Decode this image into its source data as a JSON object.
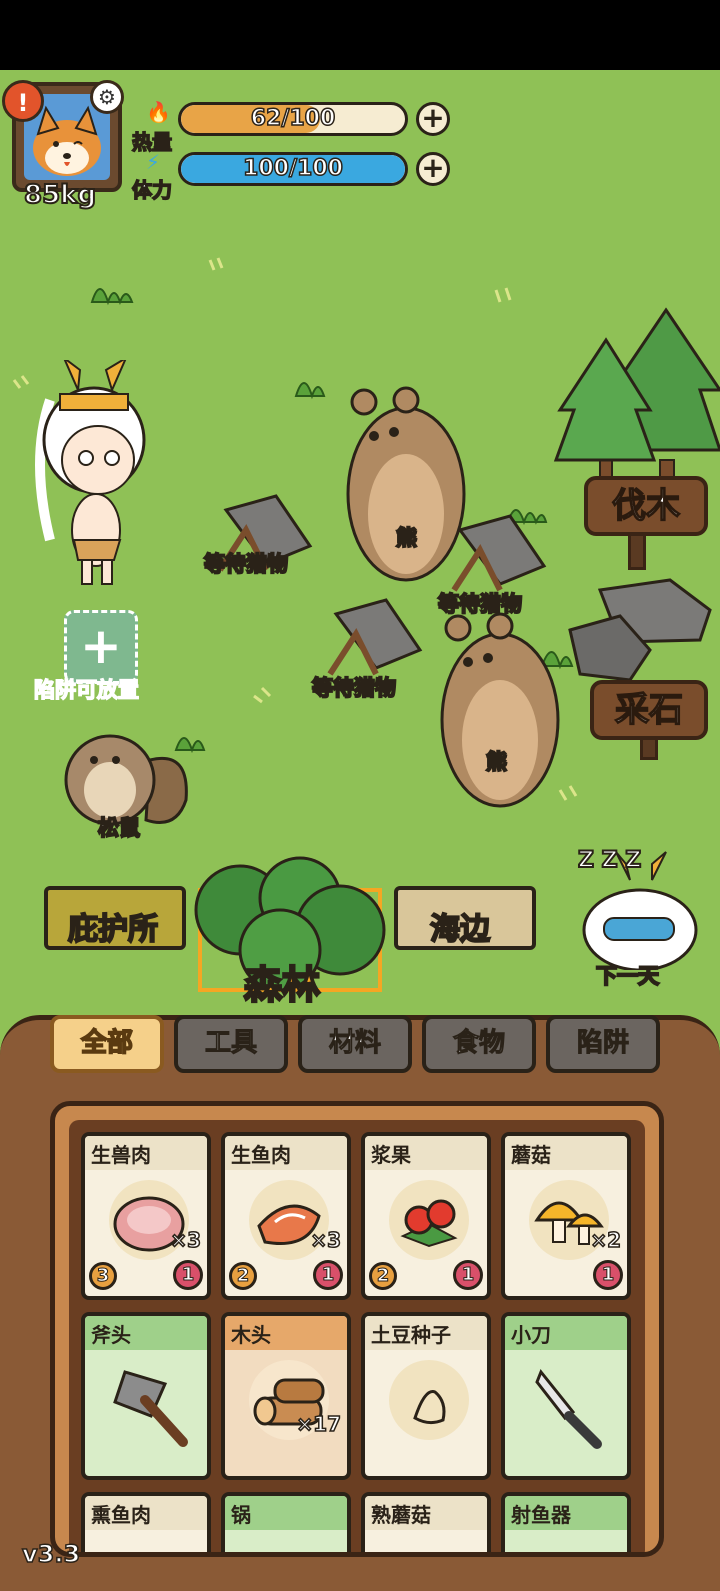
{
  "hud": {
    "weight": "85kg",
    "alert_icon": "!",
    "heat": {
      "label": "热量",
      "value": "62/100",
      "fill": 0.62,
      "color": "#e8a447"
    },
    "stamina": {
      "label": "体力",
      "value": "100/100",
      "fill": 1.0,
      "color": "#3aa8e0"
    }
  },
  "scene": {
    "trap1_label": "等待猎物",
    "trap2_label": "等待猎物",
    "trap3_label": "等待猎物",
    "bear1_label": "熊",
    "bear2_label": "熊",
    "squirrel_label": "松鼠",
    "trap_slot_label": "陷阱可放置",
    "sign_wood": "伐木",
    "sign_stone": "采石",
    "next_day_label": "下一天",
    "sleep_glyph": "Z Z Z"
  },
  "maps": {
    "shelter": "庇护所",
    "forest": "森林",
    "beach": "海边"
  },
  "filters": [
    "全部",
    "工具",
    "材料",
    "食物",
    "陷阱"
  ],
  "items_row1": [
    {
      "name": "生兽肉",
      "qty": "×3",
      "left": "3",
      "right": "1"
    },
    {
      "name": "生鱼肉",
      "qty": "×3",
      "left": "2",
      "right": "1"
    },
    {
      "name": "浆果",
      "qty": "",
      "left": "2",
      "right": "1"
    },
    {
      "name": "蘑菇",
      "qty": "×2",
      "left": "",
      "right": "1"
    }
  ],
  "items_row2": [
    {
      "name": "斧头",
      "qty": ""
    },
    {
      "name": "木头",
      "qty": "×17"
    },
    {
      "name": "土豆种子",
      "qty": ""
    },
    {
      "name": "小刀",
      "qty": ""
    }
  ],
  "items_row3": [
    "熏鱼肉",
    "锅",
    "熟蘑菇",
    "射鱼器"
  ],
  "version": "v3.3",
  "colors": {
    "grass": "#8fc156",
    "wood": "#7a4d2c",
    "accent": "#f5a623"
  }
}
